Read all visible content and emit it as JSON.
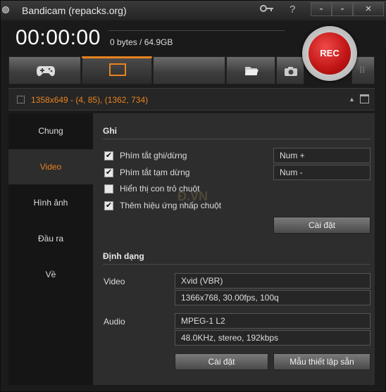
{
  "window": {
    "title": "Bandicam (repacks.org)"
  },
  "titlebar": {
    "key_icon": "key-icon",
    "help_label": "?",
    "minimize_label": "-",
    "restore_label": "-",
    "close_label": "×"
  },
  "header": {
    "timer": "00:00:00",
    "size": "0 bytes / 64.9GB"
  },
  "toolbar": {
    "buttons": [
      "game-mode",
      "screen-rect",
      "blank",
      "folder",
      "camera"
    ],
    "rec_label": "REC",
    "pause_label": "II"
  },
  "status": {
    "region": "1358x649 - (4, 85), (1362, 734)"
  },
  "sidebar": {
    "items": [
      {
        "label": "Chung"
      },
      {
        "label": "Video"
      },
      {
        "label": "Hình ảnh"
      },
      {
        "label": "Đầu ra"
      },
      {
        "label": "Về"
      }
    ]
  },
  "record": {
    "title": "Ghi",
    "options": [
      {
        "label": "Phím tắt ghi/dừng",
        "checked": true
      },
      {
        "label": "Phím tắt tạm dừng",
        "checked": true
      },
      {
        "label": "Hiển thị con trỏ chuột",
        "checked": false
      },
      {
        "label": "Thêm hiệu ứng nhấp chuột",
        "checked": true
      }
    ],
    "hotkey_record": "Num +",
    "hotkey_pause": "Num -",
    "settings_button": "Cài đặt"
  },
  "format": {
    "title": "Định dạng",
    "video_label": "Video",
    "video_codec": "Xvid (VBR)",
    "video_details": "1366x768, 30.00fps, 100q",
    "audio_label": "Audio",
    "audio_codec": "MPEG-1 L2",
    "audio_details": "48.0KHz, stereo, 192kbps",
    "settings_button": "Cài đặt",
    "presets_button": "Mẫu thiết lập sẵn"
  },
  "colors": {
    "accent": "#e8831f",
    "rec": "#c01414"
  },
  "watermark": "Đ.VN"
}
